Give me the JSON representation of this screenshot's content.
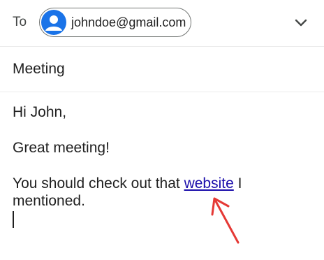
{
  "to_row": {
    "label": "To",
    "recipient": {
      "email": "johndoe@gmail.com",
      "avatar_icon": "person-avatar-icon",
      "avatar_color": "#1a73e8"
    },
    "expand_icon": "chevron-down-icon"
  },
  "subject": {
    "value": "Meeting"
  },
  "body": {
    "greeting": "Hi John,",
    "line2": "Great meeting!",
    "line3_before": "You should check out that ",
    "link_text": "website",
    "line3_after": " I mentioned.",
    "link_color": "#1a0dab"
  },
  "annotation": {
    "arrow_icon": "red-arrow-icon",
    "arrow_color": "#e53935"
  }
}
